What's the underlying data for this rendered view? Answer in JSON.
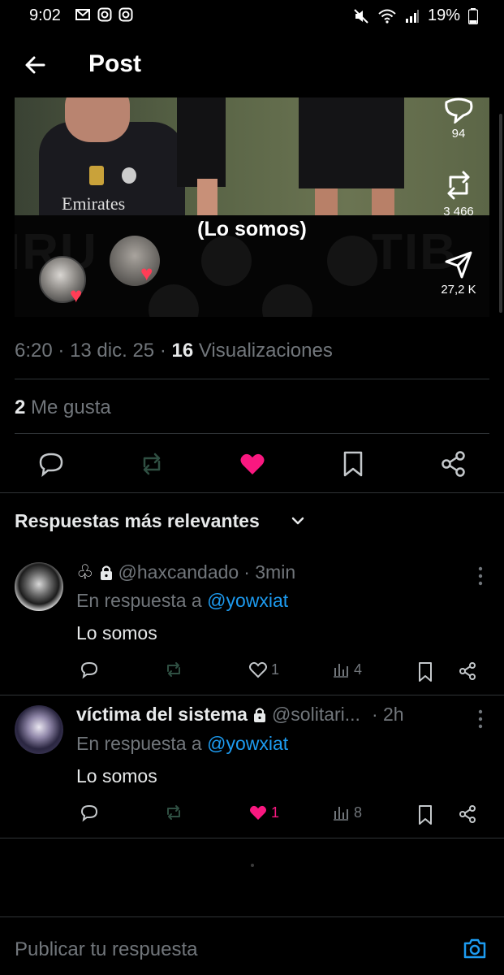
{
  "status_bar": {
    "time": "9:02",
    "battery": "19%",
    "left_icons": [
      "gmail-icon",
      "instagram-icon",
      "instagram-icon"
    ],
    "right_icons": [
      "mute-icon",
      "wifi-icon",
      "signal-icon",
      "battery-icon"
    ]
  },
  "header": {
    "title": "Post",
    "back_icon": "arrow-left-icon"
  },
  "media": {
    "caption": "(Lo somos)",
    "shirt_sponsor": "Emirates"
  },
  "media_actions": {
    "replies": "94",
    "reposts": "3 466",
    "shares": "27,2 K"
  },
  "post_meta": {
    "time": "6:20",
    "date": "13 dic. 25",
    "views_count": "16",
    "views_label": "Visualizaciones",
    "sep": "·"
  },
  "likes": {
    "count": "2",
    "label": "Me gusta"
  },
  "colors": {
    "accent_blue": "#1d9bf0",
    "like_pink": "#f91880",
    "muted": "#71767b",
    "divider": "#2f3336"
  },
  "replies_section": {
    "title": "Respuestas más relevantes"
  },
  "replies": [
    {
      "name": "",
      "club_symbol": "♧",
      "handle": "@haxcandado",
      "time": "· 3min",
      "in_reply_prefix": "En respuesta a",
      "in_reply_to": "@yowxiat",
      "text": "Lo somos",
      "likes": "1",
      "views": "4",
      "liked": false
    },
    {
      "name": "víctima del sistema",
      "handle": "@solitari...",
      "time": "· 2h",
      "in_reply_prefix": "En respuesta a",
      "in_reply_to": "@yowxiat",
      "text": "Lo somos",
      "likes": "1",
      "views": "8",
      "liked": true
    }
  ],
  "composer": {
    "placeholder": "Publicar tu respuesta"
  }
}
